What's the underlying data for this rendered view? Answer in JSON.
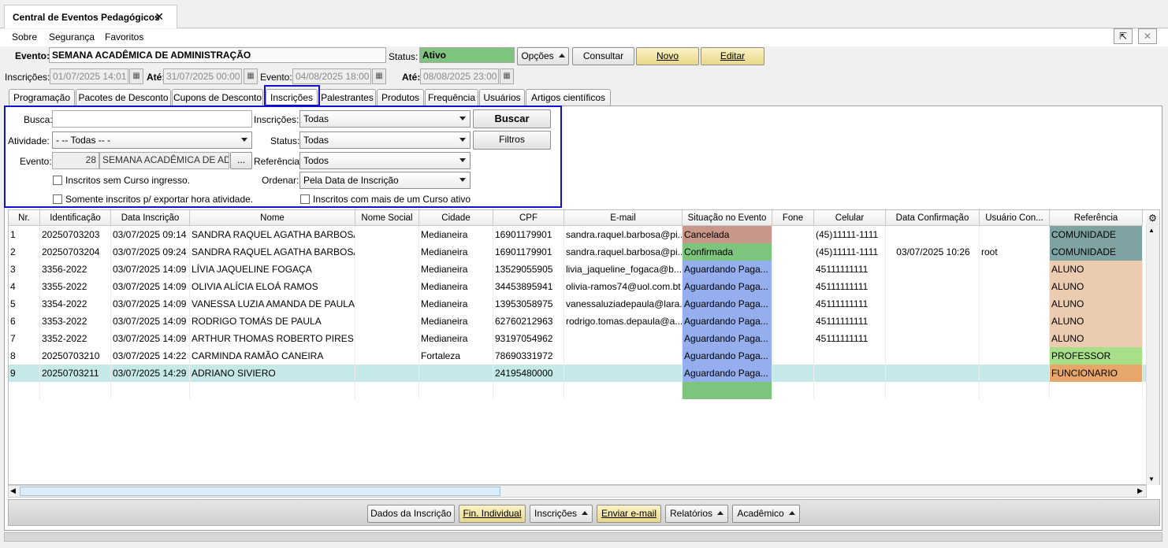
{
  "window": {
    "tab_title": "Central de Eventos Pedagógicos",
    "close_glyph": "✕"
  },
  "menu": {
    "items": [
      "Sobre",
      "Segurança",
      "Favoritos"
    ]
  },
  "header": {
    "evento_label": "Evento:",
    "evento_value": "SEMANA ACADÊMICA DE ADMINISTRAÇÃO",
    "status_label": "Status:",
    "status_value": "Ativo",
    "status_color": "#7dc47d",
    "opcoes_label": "Opções",
    "consultar_label": "Consultar",
    "novo_label": "Novo",
    "editar_label": "Editar",
    "inscricoes_label": "Inscrições:",
    "inscricoes_from": "01/07/2025 14:01",
    "ate1_label": "Até:",
    "inscricoes_to": "31/07/2025 00:00",
    "evento_date_label": "Evento:",
    "evento_from": "04/08/2025 18:00",
    "ate2_label": "Até:",
    "evento_to": "08/08/2025 23:00"
  },
  "tabs": [
    "Programação",
    "Pacotes de Desconto",
    "Cupons de Desconto",
    "Inscrições",
    "Palestrantes",
    "Produtos",
    "Frequência",
    "Usuários",
    "Artigos científicos"
  ],
  "filters": {
    "busca_label": "Busca:",
    "busca_value": "",
    "inscricoes_label": "Inscrições:",
    "inscricoes_value": "Todas",
    "buscar_label": "Buscar",
    "atividade_label": "Atividade:",
    "atividade_value": "- -- Todas -- -",
    "status_label": "Status:",
    "status_value": "Todas",
    "filtros_label": "Filtros",
    "evento_label": "Evento:",
    "evento_id": "28",
    "evento_name": "SEMANA ACADÊMICA DE ADM",
    "evento_more": "...",
    "referencia_label": "Referência",
    "referencia_value": "Todos",
    "ordenar_label": "Ordenar:",
    "ordenar_value": "Pela Data de Inscrição",
    "chk_sem_curso": "Inscritos sem Curso ingresso.",
    "chk_mais_curso": "Inscritos com mais de um Curso ativo",
    "chk_exportar": "Somente inscritos p/ exportar hora atividade."
  },
  "table": {
    "columns": [
      "Nr.",
      "Identificação",
      "Data Inscrição",
      "Nome",
      "Nome Social",
      "Cidade",
      "CPF",
      "E-mail",
      "Situação no Evento",
      "Fone",
      "Celular",
      "Data Confirmação",
      "Usuário Con...",
      "Referência"
    ],
    "rows": [
      {
        "nr": "1",
        "id": "20250703203",
        "data": "03/07/2025 09:14",
        "nome": "SANDRA RAQUEL AGATHA BARBOSA",
        "social": "",
        "cidade": "Medianeira",
        "cpf": "16901179901",
        "email": "sandra.raquel.barbosa@pi...",
        "situacao": "Cancelada",
        "sit_color": "#c8978a",
        "fone": "",
        "celular": "(45)11111-1111",
        "confirm": "",
        "usuario": "",
        "ref": "COMUNIDADE",
        "ref_color": "#7fa3a3"
      },
      {
        "nr": "2",
        "id": "20250703204",
        "data": "03/07/2025 09:24",
        "nome": "SANDRA RAQUEL AGATHA BARBOSA",
        "social": "",
        "cidade": "Medianeira",
        "cpf": "16901179901",
        "email": "sandra.raquel.barbosa@pi...",
        "situacao": "Confirmada",
        "sit_color": "#7dc47d",
        "fone": "",
        "celular": "(45)11111-1111",
        "confirm": "03/07/2025 10:26",
        "usuario": "root",
        "ref": "COMUNIDADE",
        "ref_color": "#7fa3a3"
      },
      {
        "nr": "3",
        "id": "3356-2022",
        "data": "03/07/2025 14:09",
        "nome": "LÍVIA JAQUELINE FOGAÇA",
        "social": "",
        "cidade": "Medianeira",
        "cpf": "13529055905",
        "email": "livia_jaqueline_fogaca@b...",
        "situacao": "Aguardando Paga...",
        "sit_color": "#95aeee",
        "fone": "",
        "celular": "45111111111",
        "confirm": "",
        "usuario": "",
        "ref": "ALUNO",
        "ref_color": "#ecccb0"
      },
      {
        "nr": "4",
        "id": "3355-2022",
        "data": "03/07/2025 14:09",
        "nome": "OLIVIA ALÍCIA ELOÁ RAMOS",
        "social": "",
        "cidade": "Medianeira",
        "cpf": "34453895941",
        "email": "olivia-ramos74@uol.com.bt",
        "situacao": "Aguardando Paga...",
        "sit_color": "#95aeee",
        "fone": "",
        "celular": "45111111111",
        "confirm": "",
        "usuario": "",
        "ref": "ALUNO",
        "ref_color": "#ecccb0"
      },
      {
        "nr": "5",
        "id": "3354-2022",
        "data": "03/07/2025 14:09",
        "nome": "VANESSA LUZIA AMANDA DE PAULA",
        "social": "",
        "cidade": "Medianeira",
        "cpf": "13953058975",
        "email": "vanessaluziadepaula@lara...",
        "situacao": "Aguardando Paga...",
        "sit_color": "#95aeee",
        "fone": "",
        "celular": "45111111111",
        "confirm": "",
        "usuario": "",
        "ref": "ALUNO",
        "ref_color": "#ecccb0"
      },
      {
        "nr": "6",
        "id": "3353-2022",
        "data": "03/07/2025 14:09",
        "nome": "RODRIGO TOMÁS DE PAULA",
        "social": "",
        "cidade": "Medianeira",
        "cpf": "62760212963",
        "email": "rodrigo.tomas.depaula@a...",
        "situacao": "Aguardando Paga...",
        "sit_color": "#95aeee",
        "fone": "",
        "celular": "45111111111",
        "confirm": "",
        "usuario": "",
        "ref": "ALUNO",
        "ref_color": "#ecccb0"
      },
      {
        "nr": "7",
        "id": "3352-2022",
        "data": "03/07/2025 14:09",
        "nome": "ARTHUR THOMAS ROBERTO PIRES",
        "social": "",
        "cidade": "Medianeira",
        "cpf": "93197054962",
        "email": "",
        "situacao": "Aguardando Paga...",
        "sit_color": "#95aeee",
        "fone": "",
        "celular": "45111111111",
        "confirm": "",
        "usuario": "",
        "ref": "ALUNO",
        "ref_color": "#ecccb0"
      },
      {
        "nr": "8",
        "id": "20250703210",
        "data": "03/07/2025 14:22",
        "nome": "CARMINDA RAMÃO CANEIRA",
        "social": "",
        "cidade": "Fortaleza",
        "cpf": "78690331972",
        "email": "",
        "situacao": "Aguardando Paga...",
        "sit_color": "#95aeee",
        "fone": "",
        "celular": "",
        "confirm": "",
        "usuario": "",
        "ref": "PROFESSOR",
        "ref_color": "#a8e08a"
      },
      {
        "nr": "9",
        "id": "20250703211",
        "data": "03/07/2025 14:29",
        "nome": "ADRIANO SIVIERO",
        "social": "",
        "cidade": "",
        "cpf": "24195480000",
        "email": "",
        "situacao": "Aguardando Paga...",
        "sit_color": "#95aeee",
        "fone": "",
        "celular": "",
        "confirm": "",
        "usuario": "",
        "ref": "FUNCIONARIO",
        "ref_color": "#e8a76a"
      }
    ],
    "selected_row_color": "#c5e9e9"
  },
  "bottom_buttons": [
    "Dados da Inscrição",
    "Fin. Individual",
    "Inscrições",
    "Enviar e-mail",
    "Relatórios",
    "Acadêmico"
  ]
}
